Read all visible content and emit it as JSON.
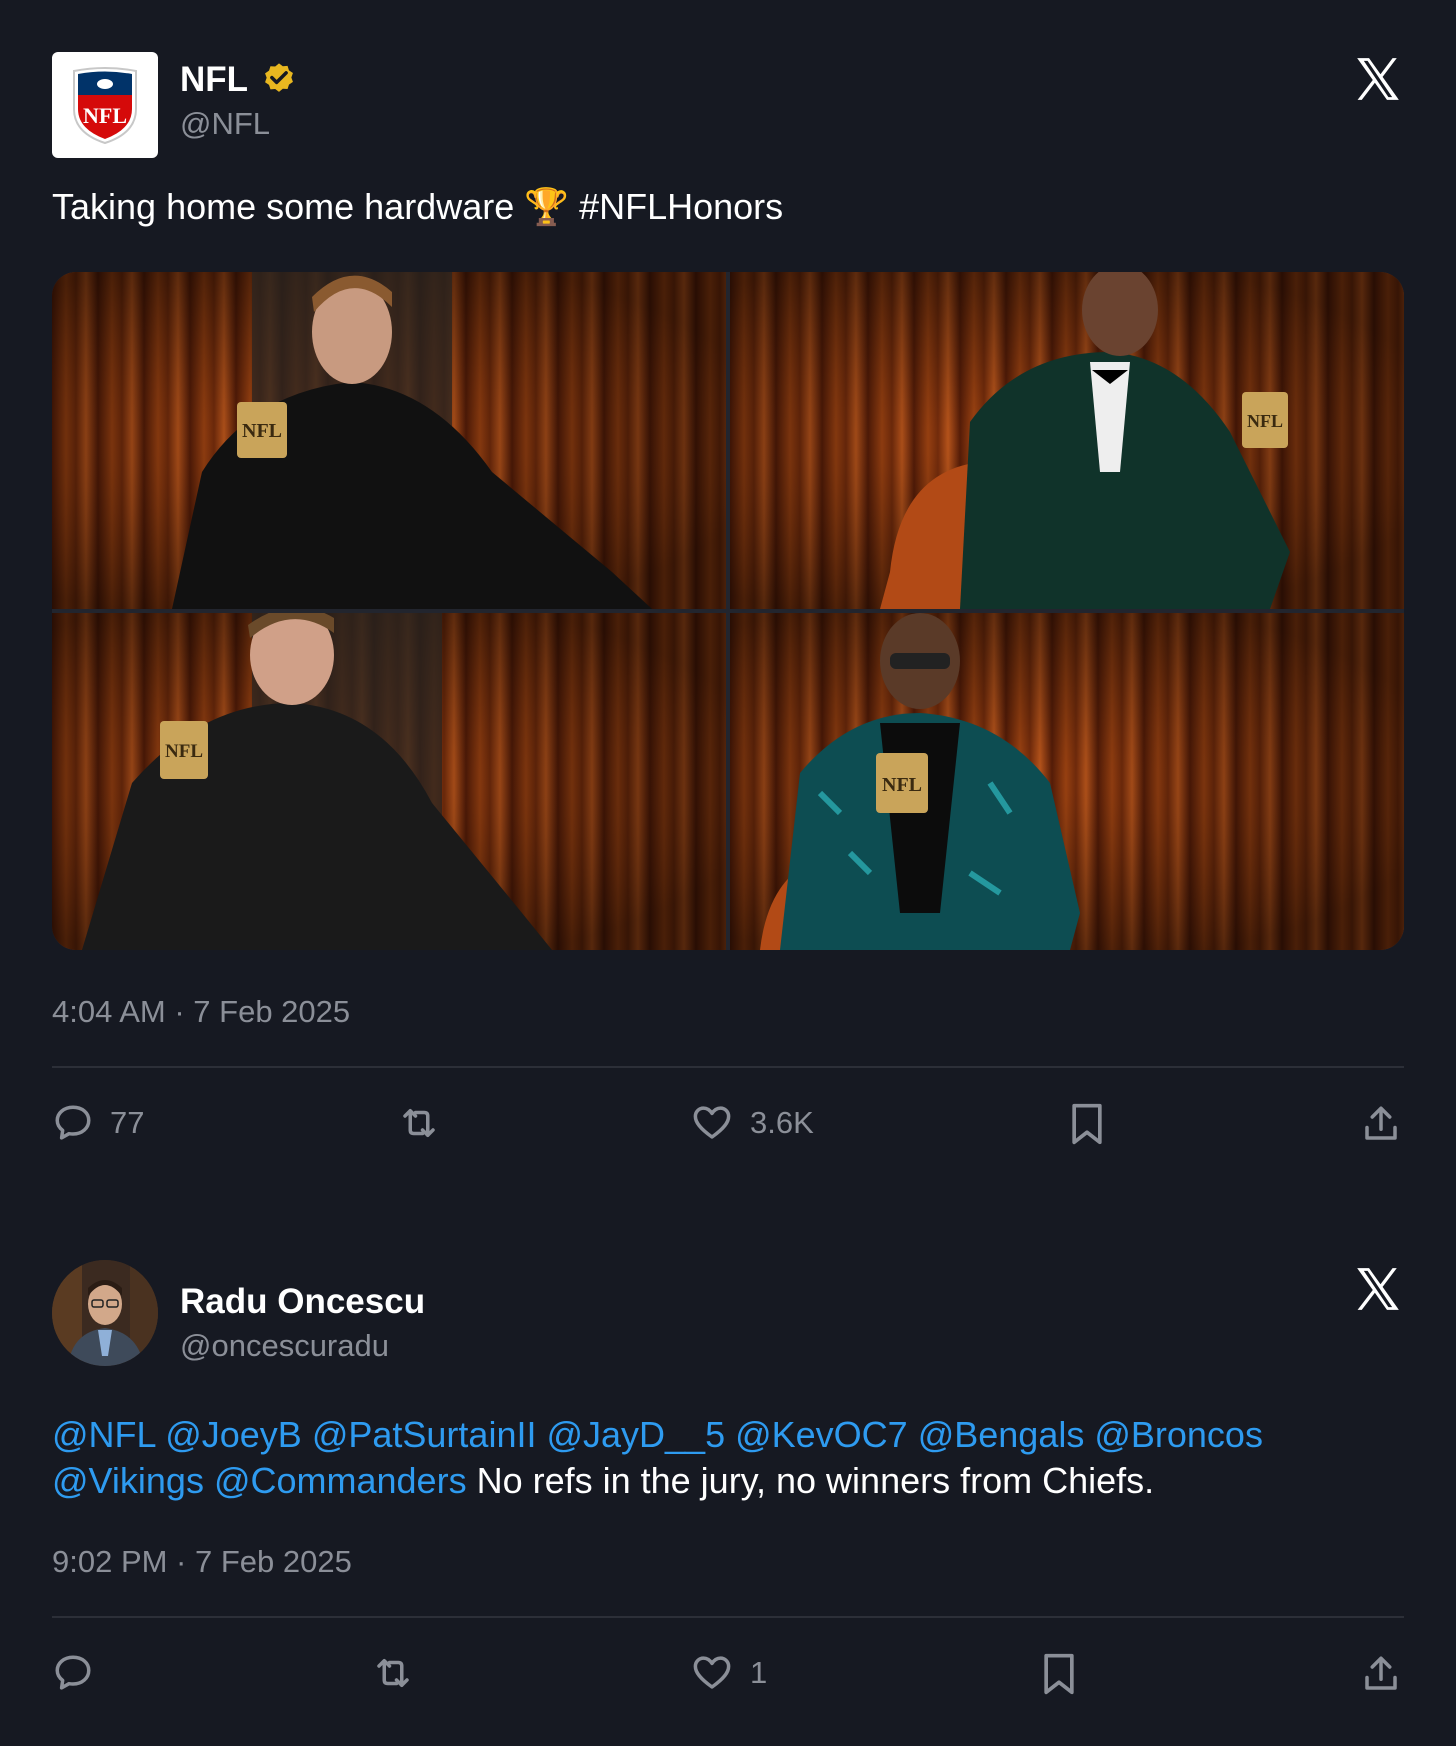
{
  "tweet1": {
    "author": {
      "display_name": "NFL",
      "handle": "@NFL",
      "verified": true,
      "avatar_icon": "nfl-shield-logo"
    },
    "text": "Taking home some hardware 🏆 #NFLHonors",
    "text_parts": {
      "plain": "Taking home some hardware ",
      "emoji": "🏆",
      "hashtag": " #NFLHonors"
    },
    "media": [
      {
        "alt_icon": "photo-player-black-suit"
      },
      {
        "alt_icon": "photo-player-green-velvet"
      },
      {
        "alt_icon": "photo-player-black-jacket"
      },
      {
        "alt_icon": "photo-player-teal-jacket"
      }
    ],
    "timestamp": "4:04 AM · 7 Feb 2025",
    "actions": {
      "reply_count": "77",
      "retweet_count": "",
      "like_count": "3.6K"
    }
  },
  "tweet2": {
    "author": {
      "display_name": "Radu Oncescu",
      "handle": "@oncescuradu",
      "avatar_icon": "user-photo-avatar"
    },
    "mentions_line1": "@NFL @JoeyB @PatSurtainII @JayD__5 @KevOC7 @Bengals @Broncos",
    "mentions_line2": "@Vikings @Commanders",
    "text_rest": " No refs in the jury, no winners from Chiefs.",
    "timestamp": "9:02 PM · 7 Feb 2025",
    "actions": {
      "reply_count": "",
      "retweet_count": "",
      "like_count": "1"
    }
  },
  "colors": {
    "background": "#161922",
    "mention": "#2e9bf0",
    "muted": "#8b8f98",
    "verified_badge": "#e8b720",
    "divider": "#2c2f38"
  }
}
